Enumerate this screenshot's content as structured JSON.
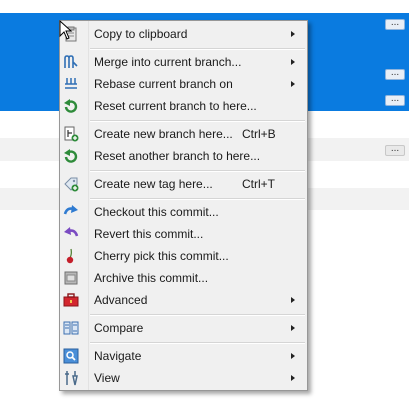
{
  "menu": {
    "items": [
      {
        "label": "Copy to clipboard",
        "icon": "clipboard-icon",
        "submenu": true
      },
      {
        "label": "Merge into current branch...",
        "icon": "merge-icon",
        "submenu": true
      },
      {
        "label": "Rebase current branch on",
        "icon": "rebase-icon",
        "submenu": true
      },
      {
        "label": "Reset current branch to here...",
        "icon": "reset-icon",
        "submenu": false
      },
      {
        "label": "Create new branch here...",
        "icon": "new-branch-icon",
        "shortcut": "Ctrl+B",
        "submenu": false
      },
      {
        "label": "Reset another branch to here...",
        "icon": "reset-icon",
        "submenu": false
      },
      {
        "label": "Create new tag here...",
        "icon": "tag-icon",
        "shortcut": "Ctrl+T",
        "submenu": false
      },
      {
        "label": "Checkout this commit...",
        "icon": "checkout-icon",
        "submenu": false
      },
      {
        "label": "Revert this commit...",
        "icon": "revert-icon",
        "submenu": false
      },
      {
        "label": "Cherry pick this commit...",
        "icon": "cherry-icon",
        "submenu": false
      },
      {
        "label": "Archive this commit...",
        "icon": "archive-icon",
        "submenu": false
      },
      {
        "label": "Advanced",
        "icon": "toolbox-icon",
        "submenu": true
      },
      {
        "label": "Compare",
        "icon": "compare-icon",
        "submenu": true
      },
      {
        "label": "Navigate",
        "icon": "navigate-icon",
        "submenu": true
      },
      {
        "label": "View",
        "icon": "view-icon",
        "submenu": true
      }
    ]
  },
  "background": {
    "more_button": "..."
  },
  "colors": {
    "selection": "#0a7be0",
    "alt_row": "#f2f2f2",
    "menu_bg": "#f0f0f0"
  }
}
